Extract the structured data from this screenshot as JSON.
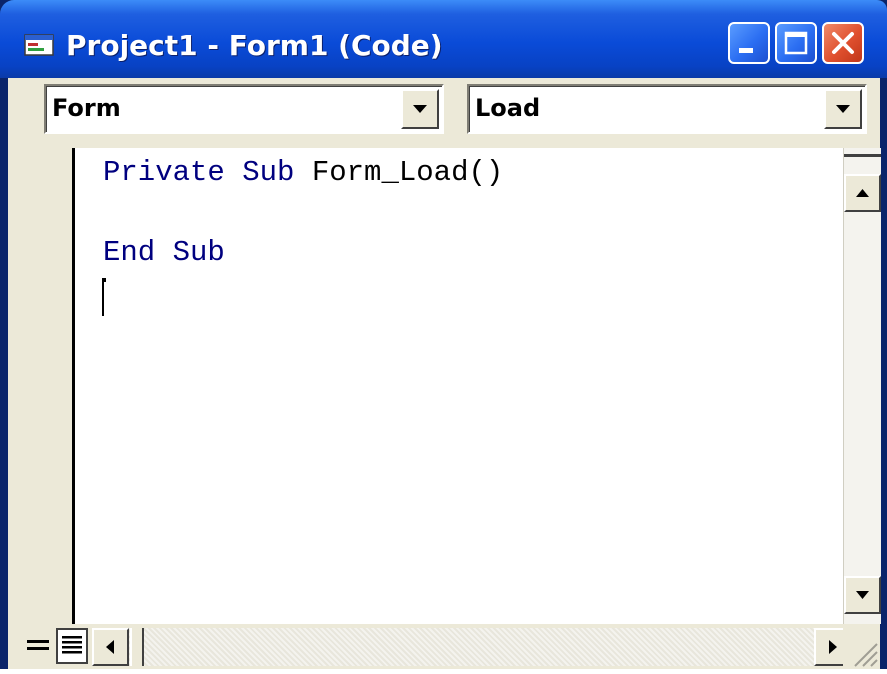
{
  "window": {
    "title": "Project1 - Form1 (Code)",
    "icon": "code-window-icon"
  },
  "controls": {
    "minimize": "minimize-icon",
    "maximize": "maximize-icon",
    "close": "close-icon"
  },
  "object_combo": {
    "value": "Form"
  },
  "procedure_combo": {
    "value": "Load"
  },
  "code": {
    "line1": {
      "keyword": "Private Sub ",
      "name": "Form_Load()"
    },
    "line2": {
      "keyword": "End Sub"
    }
  },
  "colors": {
    "keyword": "#00007f",
    "titlebar": "#0a4bd8"
  }
}
